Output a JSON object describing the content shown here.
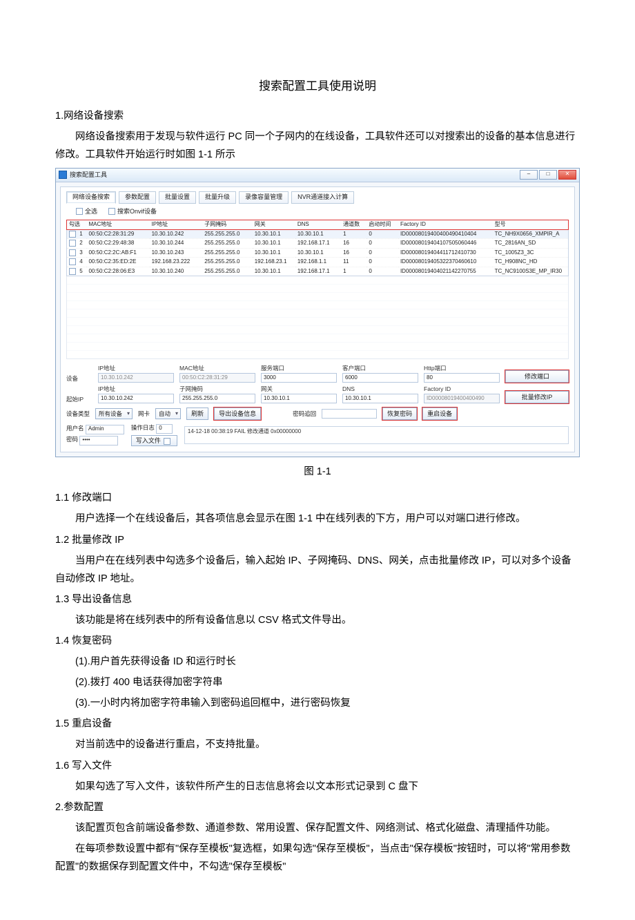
{
  "doc": {
    "title": "搜索配置工具使用说明",
    "s1_h": "1.网络设备搜索",
    "s1_p": "网络设备搜索用于发现与软件运行 PC 同一个子网内的在线设备，工具软件还可以对搜索出的设备的基本信息进行修改。工具软件开始运行时如图 1-1 所示",
    "fig_caption": "图 1-1",
    "s11_h": "1.1 修改端口",
    "s11_p": "用户选择一个在线设备后，其各项信息会显示在图 1-1 中在线列表的下方，用户可以对端口进行修改。",
    "s12_h": "1.2 批量修改 IP",
    "s12_p": "当用户在在线列表中勾选多个设备后，输入起始 IP、子网掩码、DNS、网关，点击批量修改 IP，可以对多个设备自动修改 IP 地址。",
    "s13_h": "1.3 导出设备信息",
    "s13_p": "该功能是将在线列表中的所有设备信息以 CSV 格式文件导出。",
    "s14_h": "1.4 恢复密码",
    "s14_1": "(1).用户首先获得设备 ID 和运行时长",
    "s14_2": "(2).拨打 400 电话获得加密字符串",
    "s14_3": "(3).一小时内将加密字符串输入到密码追回框中，进行密码恢复",
    "s15_h": "1.5 重启设备",
    "s15_p": "对当前选中的设备进行重启，不支持批量。",
    "s16_h": "1.6 写入文件",
    "s16_p": "如果勾选了写入文件，该软件所产生的日志信息将会以文本形式记录到 C 盘下",
    "s2_h": "2.参数配置",
    "s2_p1": "该配置页包含前端设备参数、通道参数、常用设置、保存配置文件、网络测试、格式化磁盘、清理插件功能。",
    "s2_p2": "在每项参数设置中都有\"保存至模板\"复选框，如果勾选\"保存至模板\"，当点击\"保存模板\"按钮时，可以将\"常用参数配置\"的数据保存到配置文件中，不勾选\"保存至模板\""
  },
  "app": {
    "window_title": "搜索配置工具",
    "tabs": [
      "网络设备搜索",
      "参数配置",
      "批量设置",
      "批量升级",
      "录像容量管理",
      "NVR通道接入计算"
    ],
    "select_all": "全选",
    "search_onvif": "搜索Onvif设备",
    "cols": [
      "勾选",
      "MAC地址",
      "IP地址",
      "子网掩码",
      "网关",
      "DNS",
      "通道数",
      "启动时间",
      "Factory ID",
      "型号"
    ],
    "rows": [
      {
        "n": "1",
        "mac": "00:50:C2:28:31:29",
        "ip": "10.30.10.242",
        "mask": "255.255.255.0",
        "gw": "10.30.10.1",
        "dns": "10.30.10.1",
        "ch": "1",
        "st": "0",
        "fid": "ID00008019400400490410404",
        "model": "TC_NH9X0656_XMPIR_A"
      },
      {
        "n": "2",
        "mac": "00:50:C2:29:48:38",
        "ip": "10.30.10.244",
        "mask": "255.255.255.0",
        "gw": "10.30.10.1",
        "dns": "192.168.17.1",
        "ch": "16",
        "st": "0",
        "fid": "ID00008019404107505060446",
        "model": "TC_2816AN_SD"
      },
      {
        "n": "3",
        "mac": "00:50:C2:2C:AB:F1",
        "ip": "10.30.10.243",
        "mask": "255.255.255.0",
        "gw": "10.30.10.1",
        "dns": "10.30.10.1",
        "ch": "16",
        "st": "0",
        "fid": "ID00008019404411712410730",
        "model": "TC_1005Z3_3C"
      },
      {
        "n": "4",
        "mac": "00:50:C2:35:ED:2E",
        "ip": "192.168.23.222",
        "mask": "255.255.255.0",
        "gw": "192.168.23.1",
        "dns": "192.168.1.1",
        "ch": "11",
        "st": "0",
        "fid": "ID00008019405322370460610",
        "model": "TC_H908NC_HD"
      },
      {
        "n": "5",
        "mac": "00:50:C2:28:06:E3",
        "ip": "10.30.10.240",
        "mask": "255.255.255.0",
        "gw": "10.30.10.1",
        "dns": "192.168.17.1",
        "ch": "1",
        "st": "0",
        "fid": "ID00008019404021142270755",
        "model": "TC_NC9100S3E_MP_IR30"
      }
    ],
    "form": {
      "row_device": "设备",
      "ip_lbl": "IP地址",
      "ip_val": "10.30.10.242",
      "mac_lbl": "MAC地址",
      "mac_val": "00:50:C2:28:31:29",
      "srv_port_lbl": "服务端口",
      "srv_port_val": "3000",
      "cli_port_lbl": "客户端口",
      "cli_port_val": "6000",
      "http_port_lbl": "Http端口",
      "http_port_val": "80",
      "btn_mod_port": "修改端口",
      "row_start": "起始IP",
      "start_ip_val": "10.30.10.242",
      "mask_lbl": "子网掩码",
      "mask_val": "255.255.255.0",
      "gw_lbl": "网关",
      "gw_val": "10.30.10.1",
      "dns_lbl": "DNS",
      "dns_val": "10.30.10.1",
      "fid_lbl": "Factory ID",
      "fid_val": "ID00008019400400490",
      "btn_batch_ip": "批量修改IP"
    },
    "row_controls": {
      "dev_type_lbl": "设备类型",
      "dev_type_val": "所有设备",
      "nic_lbl": "网卡",
      "nic_val": "自动",
      "btn_refresh": "刷新",
      "btn_export": "导出设备信息",
      "pwd_recover_lbl": "密码追回",
      "btn_recover": "恢复密码",
      "btn_reboot": "重启设备"
    },
    "footer": {
      "user_lbl": "用户名",
      "user_val": "Admin",
      "pwd_lbl": "密码",
      "pwd_val": "••••",
      "log_lbl": "操作日志",
      "log_count": "0",
      "log_line": "14-12-18 00:38:19  FAIL    修改通道  0x00000000",
      "write_file": "写入文件"
    }
  }
}
